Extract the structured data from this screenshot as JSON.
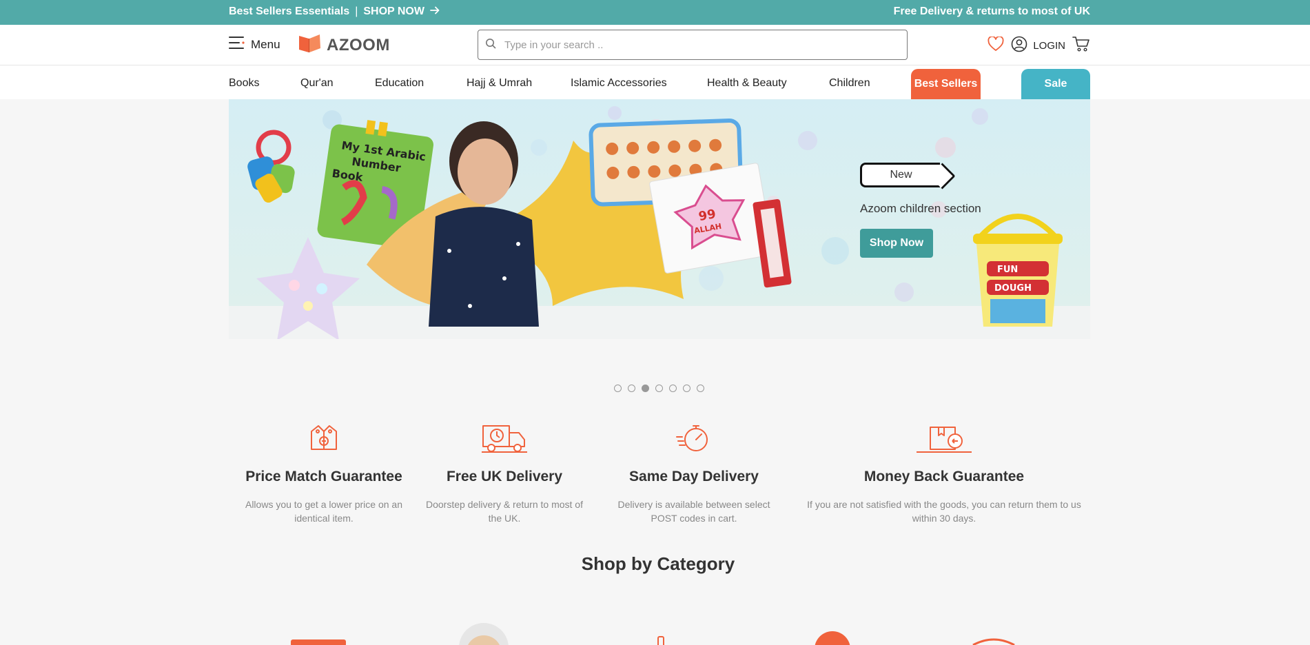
{
  "topbar": {
    "left_text": "Best Sellers Essentials",
    "divider": "|",
    "shop_now": "SHOP NOW",
    "right_text": "Free Delivery & returns to most of UK"
  },
  "header": {
    "menu_label": "Menu",
    "logo_text": "AZOOM",
    "search_placeholder": "Type in your search ..",
    "login_label": "LOGIN"
  },
  "nav": {
    "items": [
      "Books",
      "Qur'an",
      "Education",
      "Hajj & Umrah",
      "Islamic Accessories",
      "Health & Beauty",
      "Children"
    ],
    "best_sellers": "Best Sellers",
    "sale": "Sale"
  },
  "hero": {
    "tag": "New",
    "subtitle": "Azoom children section",
    "button": "Shop Now",
    "slide_count": 7,
    "active_slide": 3
  },
  "features": [
    {
      "title": "Price Match Guarantee",
      "desc": "Allows you to get a lower price on an identical item."
    },
    {
      "title": "Free UK Delivery",
      "desc": "Doorstep delivery & return to most of the UK."
    },
    {
      "title": "Same Day Delivery",
      "desc": "Delivery is available between select POST codes in cart."
    },
    {
      "title": "Money Back Guarantee",
      "desc": "If you are not satisfied with the goods, you can return them to us within 30 days."
    }
  ],
  "section": {
    "title": "Shop by Category"
  },
  "colors": {
    "topbar": "#52aaa8",
    "accent_orange": "#f0623c",
    "sale_blue": "#45b4c6",
    "shop_now_teal": "#3f9c9a"
  }
}
